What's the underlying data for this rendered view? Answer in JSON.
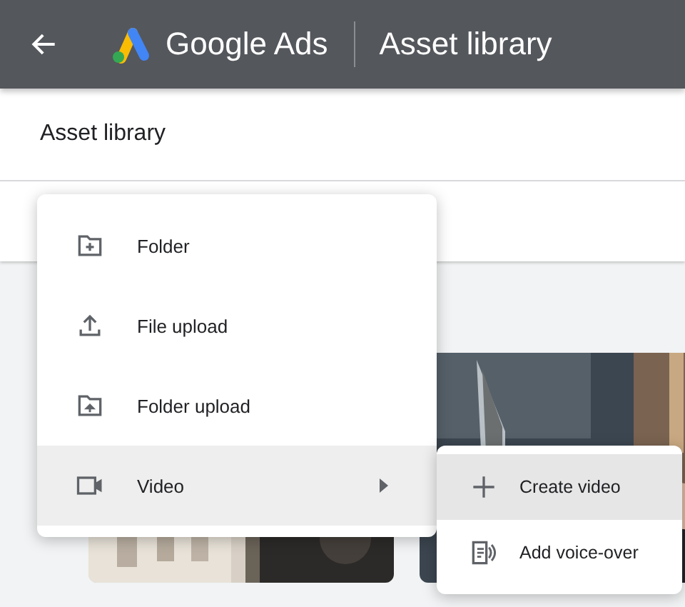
{
  "header": {
    "brand": "Google Ads",
    "title": "Asset library"
  },
  "page_title": "Asset library",
  "menu": {
    "items": [
      {
        "label": "Folder",
        "selected": false,
        "submenu": false
      },
      {
        "label": "File upload",
        "selected": false,
        "submenu": false
      },
      {
        "label": "Folder upload",
        "selected": false,
        "submenu": false
      },
      {
        "label": "Video",
        "selected": true,
        "submenu": true
      }
    ]
  },
  "submenu": {
    "items": [
      {
        "label": "Create video",
        "selected": true
      },
      {
        "label": "Add voice-over",
        "selected": false
      }
    ]
  }
}
